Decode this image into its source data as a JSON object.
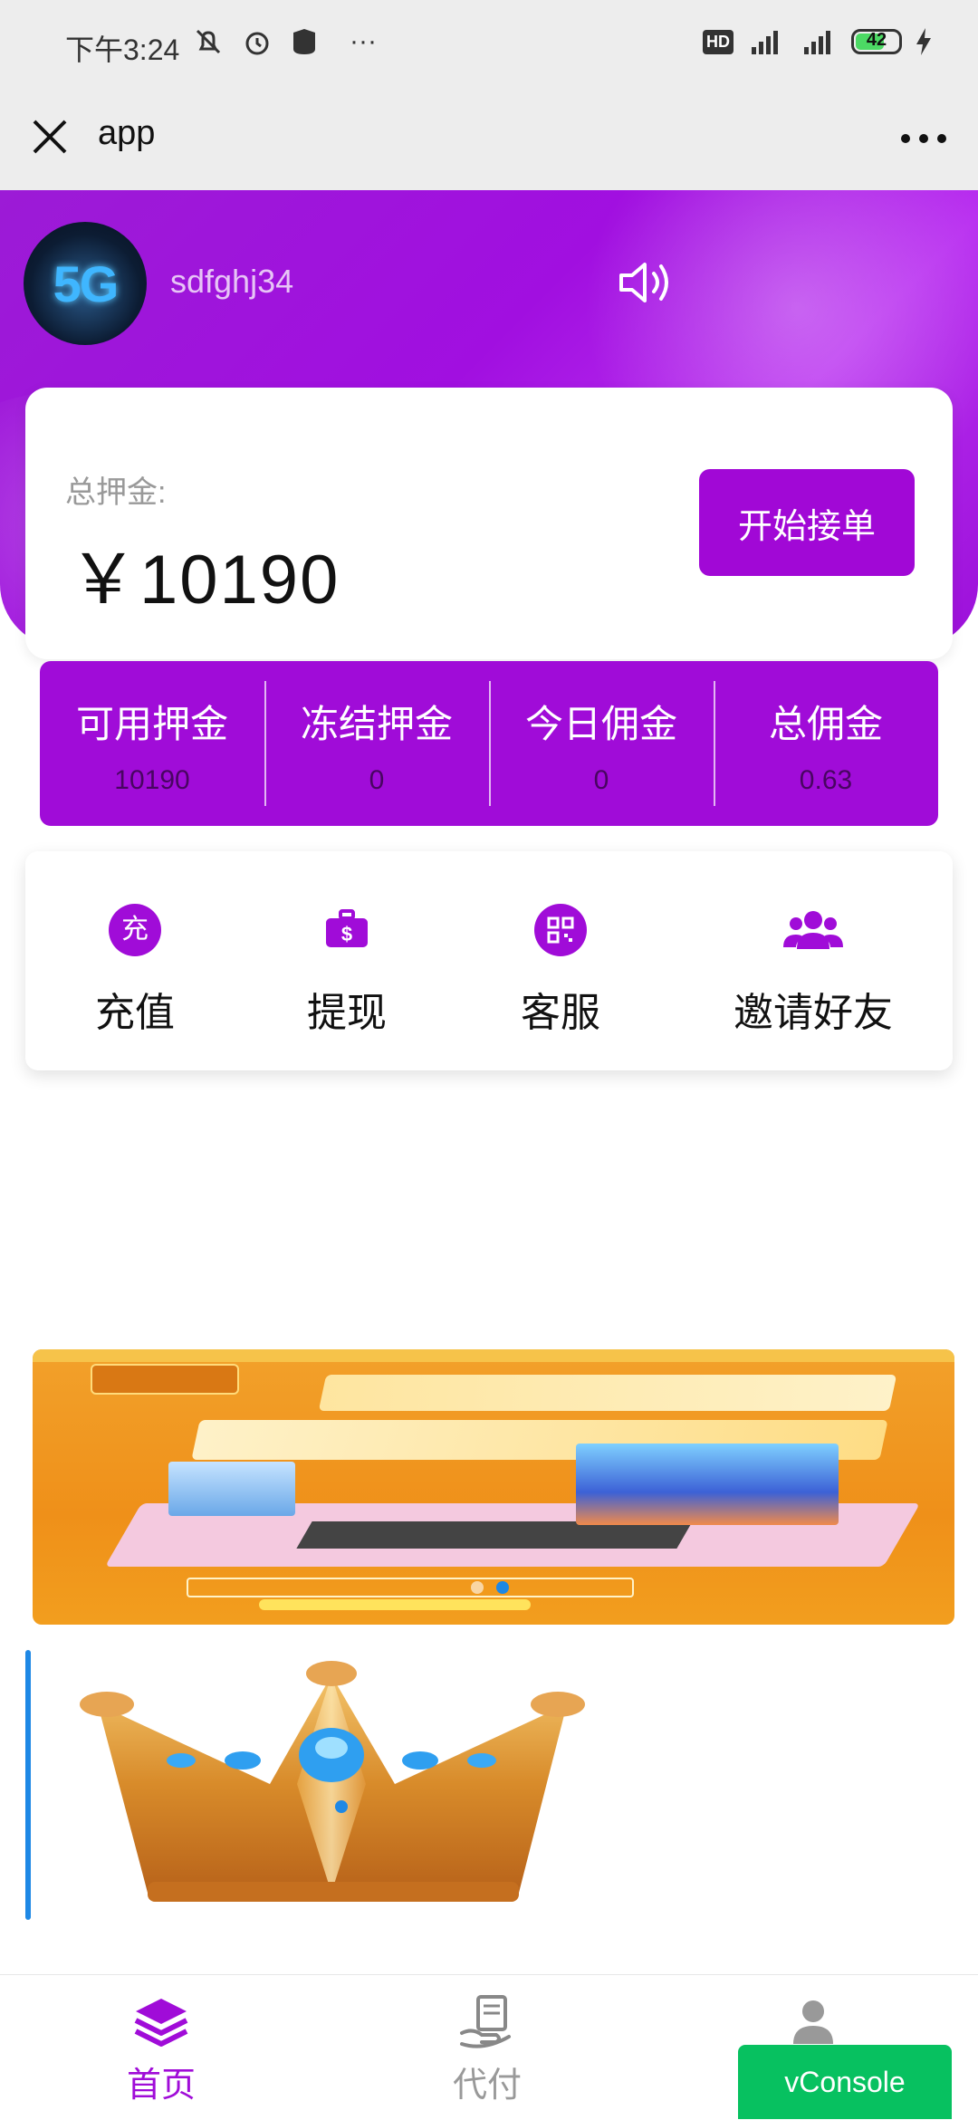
{
  "status_bar": {
    "time": "下午3:24",
    "battery": "42",
    "hd": "HD",
    "network": "4G"
  },
  "nav": {
    "title": "app"
  },
  "profile": {
    "username": "sdfghj34",
    "avatar_text": "5G"
  },
  "deposit": {
    "label": "总押金:",
    "amount": "￥10190",
    "start_button": "开始接单"
  },
  "stats": [
    {
      "label": "可用押金",
      "value": "10190"
    },
    {
      "label": "冻结押金",
      "value": "0"
    },
    {
      "label": "今日佣金",
      "value": "0"
    },
    {
      "label": "总佣金",
      "value": "0.63"
    }
  ],
  "actions": [
    {
      "label": "充值",
      "icon": "recharge-icon",
      "icon_text": "充"
    },
    {
      "label": "提现",
      "icon": "wallet-icon"
    },
    {
      "label": "客服",
      "icon": "qrcode-icon"
    },
    {
      "label": "邀请好友",
      "icon": "users-icon"
    }
  ],
  "tabs": [
    {
      "label": "首页",
      "icon": "layers-icon",
      "active": true
    },
    {
      "label": "代付",
      "icon": "hand-receipt-icon",
      "active": false
    },
    {
      "label": "",
      "icon": "user-icon",
      "active": false
    }
  ],
  "vconsole": "vConsole",
  "colors": {
    "brand_purple": "#a00cd8",
    "vconsole_green": "#07c160",
    "dot_blue": "#1e88e5"
  }
}
